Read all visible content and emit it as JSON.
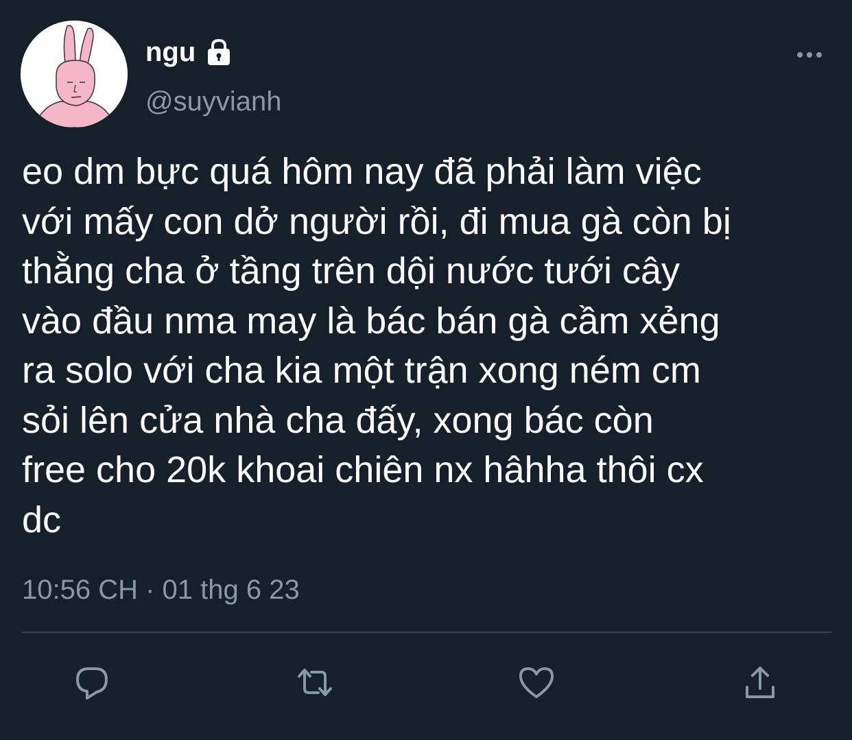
{
  "user": {
    "display_name": "ngu",
    "handle": "@suyvianh",
    "protected_icon": "lock-icon",
    "avatar_description_icon": "pink-bunny-avatar"
  },
  "tweet": {
    "text": "eo dm bực quá hôm nay đã phải làm việc\nvới mấy con dở người rồi, đi mua gà còn bị\nthằng cha ở tầng trên dội nước tưới cây\nvào đầu nma may là bác bán gà cầm xẻng\nra solo với cha kia một trận xong ném cm\nsỏi lên cửa nhà cha đấy, xong bác còn\nfree cho 20k khoai chiên nx hâhha thôi cx\ndc",
    "timestamp": "10:56 CH · 01 thg 6 23"
  },
  "actions": {
    "reply_icon": "reply-icon",
    "retweet_icon": "retweet-icon",
    "like_icon": "heart-icon",
    "share_icon": "share-icon",
    "more_icon": "more-icon"
  },
  "colors": {
    "background": "#15202b",
    "text_primary": "#ffffff",
    "text_secondary": "#8899a6",
    "divider": "#38444d",
    "avatar_pink": "#f4b6c8"
  }
}
